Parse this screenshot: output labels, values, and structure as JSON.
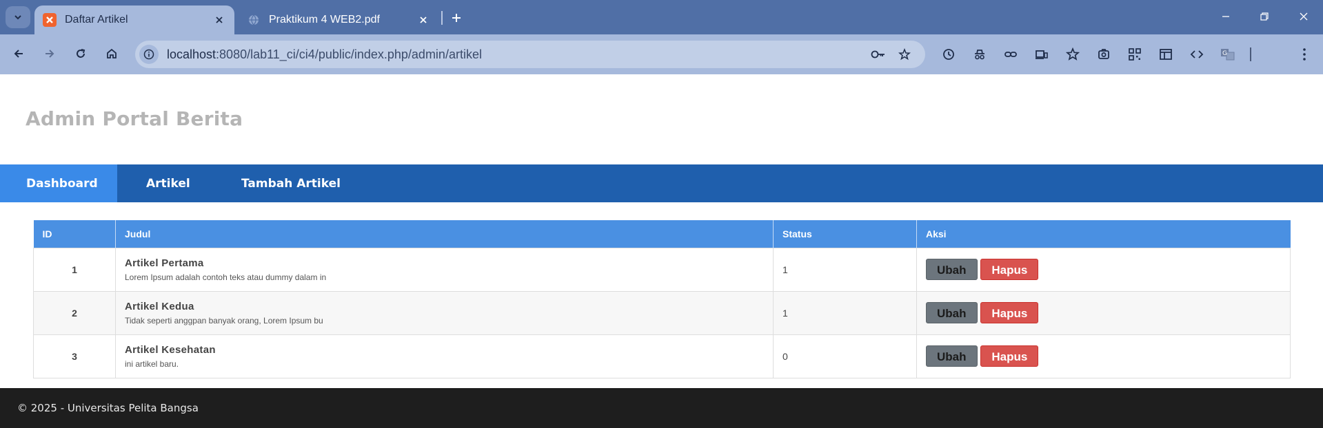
{
  "browser": {
    "tabs": [
      {
        "title": "Daftar Artikel",
        "favicon": "xampp-icon",
        "active": true
      },
      {
        "title": "Praktikum 4 WEB2.pdf",
        "favicon": "globe-icon",
        "active": false
      }
    ],
    "address": {
      "host": "localhost",
      "path": ":8080/lab11_ci/ci4/public/index.php/admin/artikel"
    },
    "colors": {
      "tabstrip": "#506fa6",
      "toolbar": "#a6b9dc"
    }
  },
  "site": {
    "title": "Admin Portal Berita",
    "nav": [
      {
        "label": "Dashboard",
        "active": true
      },
      {
        "label": "Artikel",
        "active": false
      },
      {
        "label": "Tambah Artikel",
        "active": false
      }
    ],
    "colors": {
      "nav_bg": "#1f5fad",
      "nav_active": "#3a8ae8",
      "table_header": "#4a90e2",
      "btn_edit": "#6c757d",
      "btn_delete": "#d9534f",
      "footer_bg": "#1e1e1e"
    }
  },
  "table": {
    "headers": [
      "ID",
      "Judul",
      "Status",
      "Aksi"
    ],
    "rows": [
      {
        "id": "1",
        "title": "Artikel Pertama",
        "excerpt": "Lorem Ipsum adalah contoh teks atau dummy dalam in",
        "status": "1",
        "edit": "Ubah",
        "delete": "Hapus"
      },
      {
        "id": "2",
        "title": "Artikel Kedua",
        "excerpt": "Tidak seperti anggpan banyak orang, Lorem Ipsum bu",
        "status": "1",
        "edit": "Ubah",
        "delete": "Hapus"
      },
      {
        "id": "3",
        "title": "Artikel Kesehatan",
        "excerpt": "ini artikel baru.",
        "status": "0",
        "edit": "Ubah",
        "delete": "Hapus"
      }
    ]
  },
  "footer": {
    "text": "© 2025 - Universitas Pelita Bangsa"
  }
}
